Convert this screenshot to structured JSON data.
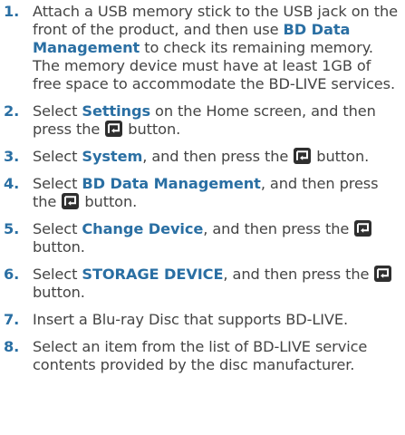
{
  "steps": [
    {
      "num": "1.",
      "segments": [
        {
          "t": "Attach a USB memory stick to the USB jack on the front of the product, and then use "
        },
        {
          "t": "BD Data Management",
          "b": true
        },
        {
          "t": " to check its remaining memory. The memory device must have at least 1GB of free space to accommodate the BD-LIVE services."
        }
      ]
    },
    {
      "num": "2.",
      "segments": [
        {
          "t": "Select "
        },
        {
          "t": "Settings",
          "b": true
        },
        {
          "t": " on the Home screen, and then press the "
        },
        {
          "icon": "enter-button-icon"
        },
        {
          "t": " button."
        }
      ]
    },
    {
      "num": "3.",
      "segments": [
        {
          "t": "Select "
        },
        {
          "t": "System",
          "b": true
        },
        {
          "t": ", and then press the "
        },
        {
          "icon": "enter-button-icon"
        },
        {
          "t": " button."
        }
      ]
    },
    {
      "num": "4.",
      "segments": [
        {
          "t": "Select "
        },
        {
          "t": "BD Data Management",
          "b": true
        },
        {
          "t": ", and then press the "
        },
        {
          "icon": "enter-button-icon"
        },
        {
          "t": " button."
        }
      ]
    },
    {
      "num": "5.",
      "segments": [
        {
          "t": "Select "
        },
        {
          "t": "Change Device",
          "b": true
        },
        {
          "t": ", and then press the "
        },
        {
          "icon": "enter-button-icon"
        },
        {
          "t": " button."
        }
      ]
    },
    {
      "num": "6.",
      "segments": [
        {
          "t": "Select "
        },
        {
          "t": "STORAGE DEVICE",
          "b": true
        },
        {
          "t": ", and then press the "
        },
        {
          "icon": "enter-button-icon"
        },
        {
          "t": " button."
        }
      ]
    },
    {
      "num": "7.",
      "segments": [
        {
          "t": "Insert a Blu-ray Disc that supports BD-LIVE."
        }
      ]
    },
    {
      "num": "8.",
      "segments": [
        {
          "t": "Select an item from the list of BD-LIVE service contents provided by the disc manufacturer."
        }
      ]
    }
  ],
  "colors": {
    "accent": "#2a6fa3",
    "text": "#444444",
    "icon_bg": "#2f2f2f"
  }
}
